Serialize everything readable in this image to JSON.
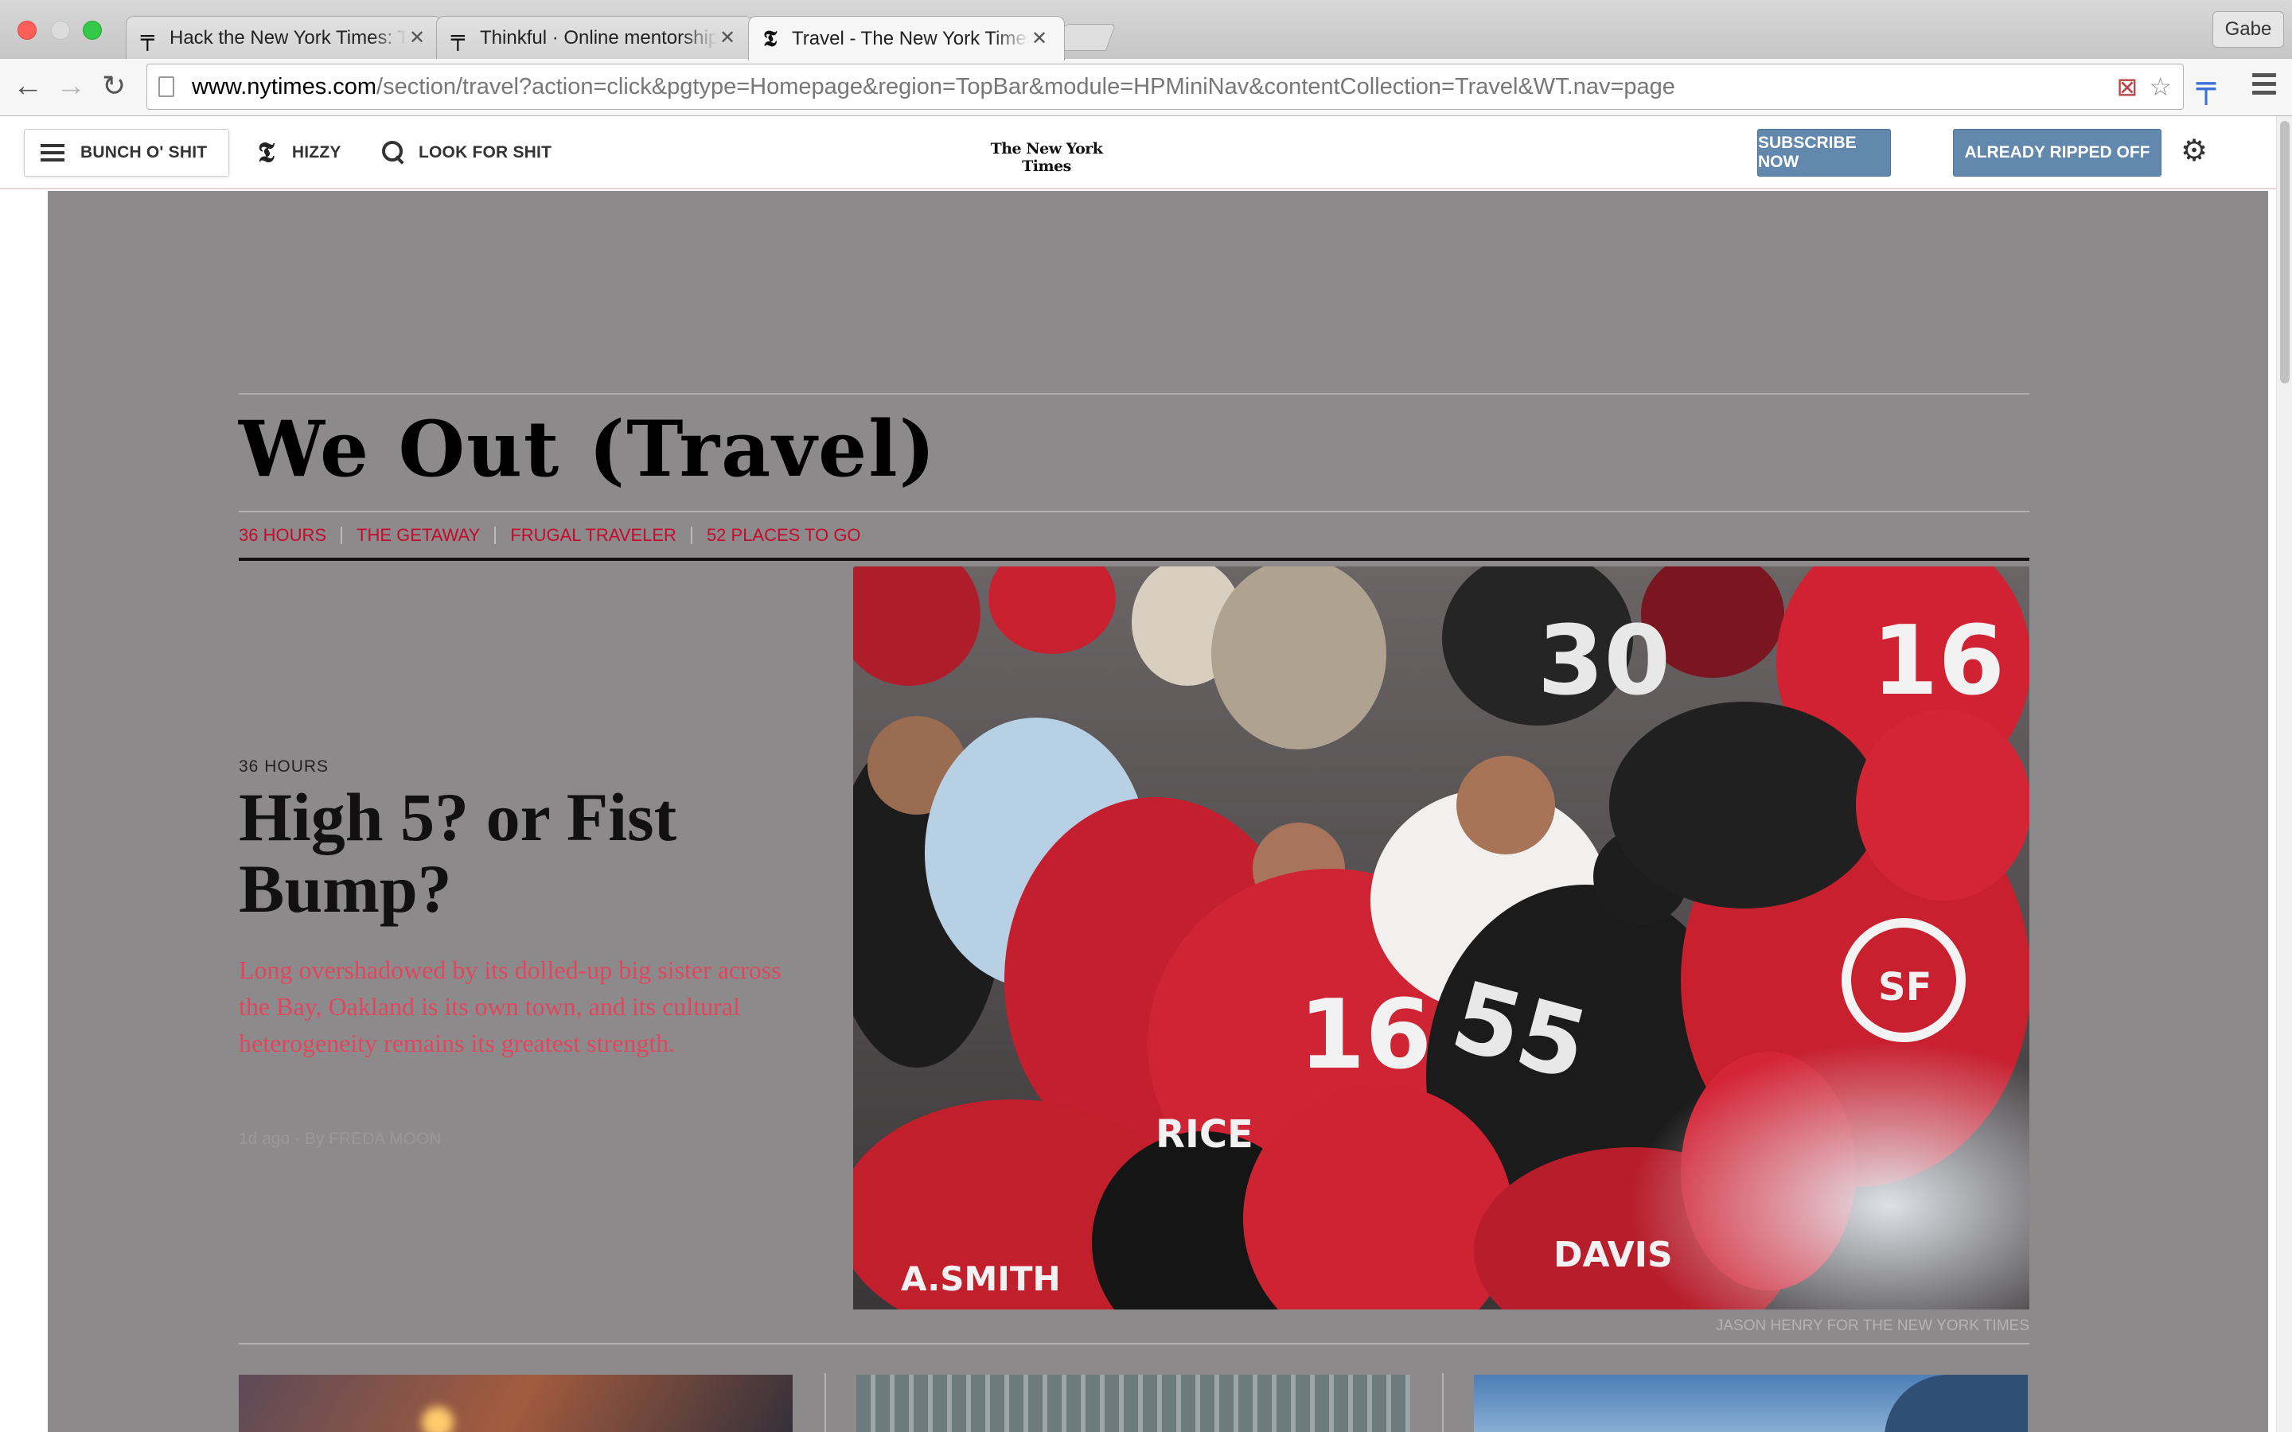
{
  "browser": {
    "tabs": [
      {
        "title": "Hack the New York Times: Te",
        "favicon": "thinkful-icon",
        "active": false
      },
      {
        "title": "Thinkful · Online mentorship",
        "favicon": "thinkful-icon",
        "active": false
      },
      {
        "title": "Travel - The New York Times",
        "favicon": "nyt-t-icon",
        "active": true
      }
    ],
    "profile_name": "Gabe",
    "url_host": "www.nytimes.com",
    "url_path": "/section/travel?action=click&pgtype=Homepage&region=TopBar&module=HPMiniNav&contentCollection=Travel&WT.nav=page",
    "icons": {
      "back": "←",
      "forward": "→",
      "reload": "↻",
      "star": "☆",
      "ext": "╤"
    }
  },
  "masthead": {
    "sections_label": "BUNCH O' SHIT",
    "home_label": "HIZZY",
    "search_label": "LOOK FOR SHIT",
    "logo_text": "The New York Times",
    "subscribe_label": "SUBSCRIBE NOW",
    "login_label": "ALREADY RIPPED OFF",
    "t_logo": "𝕿",
    "gear": "⚙"
  },
  "section": {
    "title": "We Out (Travel)",
    "subnav": [
      "36 HOURS",
      "THE GETAWAY",
      "FRUGAL TRAVELER",
      "52 PLACES TO GO"
    ]
  },
  "lead_story": {
    "kicker": "36 HOURS",
    "headline": "High 5? or Fist Bump?",
    "summary": "Long overshadowed by its dolled-up big sister across the Bay, Oakland is its own town, and its cultural heterogeneity remains its greatest strength.",
    "byline": "1d ago · By FREDA MOON",
    "image_credit": "JASON HENRY FOR THE NEW YORK TIMES",
    "image_jersey_numbers": [
      "30",
      "16",
      "55",
      "16",
      "A.SMITH",
      "RICE",
      "DAVIS",
      "SF"
    ]
  },
  "colors": {
    "overlay": "#8d8a8b",
    "accent_red": "#c60a2c",
    "summary_red": "#e0475e",
    "button_blue": "#6288ad"
  }
}
